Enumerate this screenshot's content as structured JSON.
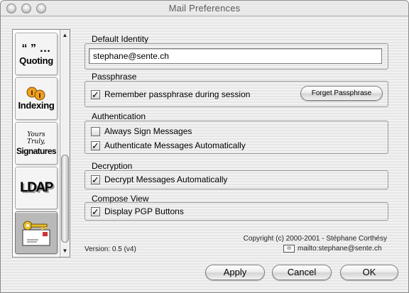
{
  "window": {
    "title": "Mail Preferences"
  },
  "sidebar": {
    "items": [
      {
        "icon": "“ ” …",
        "label": "Quoting"
      },
      {
        "icon": "I I",
        "label": "Indexing"
      },
      {
        "icon": "Yours Truly,",
        "label": "Signatures"
      },
      {
        "icon": "",
        "label": "LDAP"
      },
      {
        "icon": "",
        "label": ""
      }
    ]
  },
  "default_identity": {
    "title": "Default Identity",
    "value": "stephane@sente.ch"
  },
  "passphrase": {
    "title": "Passphrase",
    "remember_label": "Remember passphrase during session",
    "remember_checked": true,
    "forget_button": "Forget Passphrase"
  },
  "authentication": {
    "title": "Authentication",
    "always_sign_label": "Always Sign Messages",
    "always_sign_checked": false,
    "auto_auth_label": "Authenticate Messages Automatically",
    "auto_auth_checked": true
  },
  "decryption": {
    "title": "Decryption",
    "auto_decrypt_label": "Decrypt Messages Automatically",
    "auto_decrypt_checked": true
  },
  "compose_view": {
    "title": "Compose View",
    "display_pgp_label": "Display PGP Buttons",
    "display_pgp_checked": true
  },
  "footer": {
    "version": "Version: 0.5 (v4)",
    "copyright": "Copyright (c) 2000-2001 - Stéphane Corthésy",
    "mailto": "mailto:stephane@sente.ch"
  },
  "buttons": {
    "apply": "Apply",
    "cancel": "Cancel",
    "ok": "OK"
  },
  "check_mark": "✓"
}
